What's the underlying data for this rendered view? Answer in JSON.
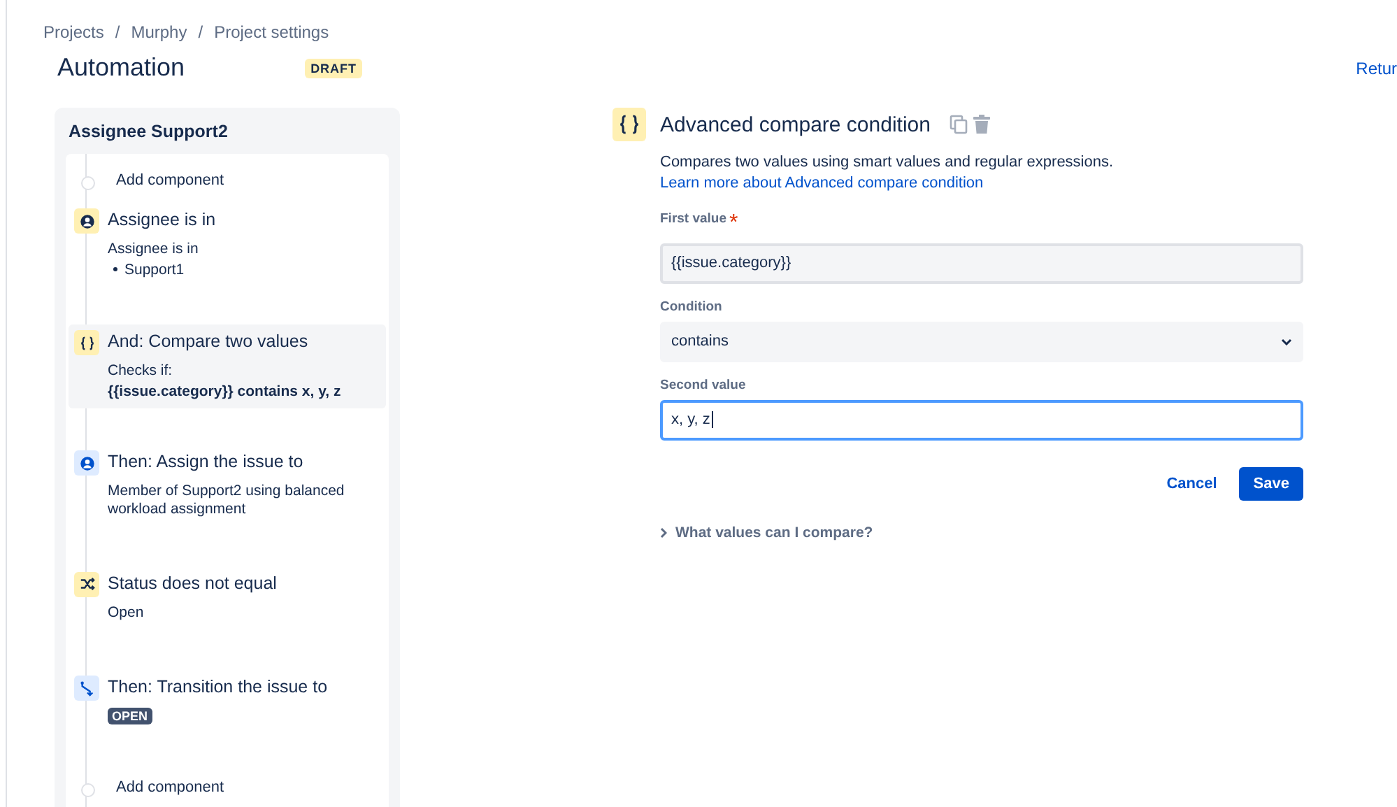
{
  "breadcrumbs": [
    "Projects",
    "Murphy",
    "Project settings"
  ],
  "breadcrumb_separator": "/",
  "title": "Automation",
  "status_badge": "DRAFT",
  "return_link": "Retur",
  "rule": {
    "name": "Assignee Support2",
    "steps": [
      {
        "kind": "add",
        "title": "Add component",
        "selected": false
      },
      {
        "kind": "user-condition",
        "title": "Assignee is in",
        "selected": false,
        "details": [
          {
            "kind": "plain",
            "text": "Assignee is in"
          },
          {
            "kind": "bullet",
            "text": "Support1"
          }
        ]
      },
      {
        "kind": "compare-condition",
        "title": "And: Compare two values",
        "selected": true,
        "details": [
          {
            "kind": "plain",
            "text": "Checks if:"
          },
          {
            "kind": "bold",
            "text": "{{issue.category}} contains x, y, z"
          }
        ]
      },
      {
        "kind": "assign-action",
        "title": "Then: Assign the issue to",
        "selected": false,
        "details": [
          {
            "kind": "plain",
            "text": "Member of Support2 using balanced workload assignment"
          }
        ]
      },
      {
        "kind": "status-condition",
        "title": "Status does not equal",
        "selected": false,
        "details": [
          {
            "kind": "plain",
            "text": "Open"
          }
        ]
      },
      {
        "kind": "transition-action",
        "title": "Then: Transition the issue to",
        "selected": false,
        "details": [
          {
            "kind": "lozenge",
            "text": "OPEN"
          }
        ]
      },
      {
        "kind": "add",
        "title": "Add component",
        "selected": false
      }
    ]
  },
  "editor": {
    "title": "Advanced compare condition",
    "description": "Compares two values using smart values and regular expressions.",
    "learn_more_link": "Learn more about Advanced compare condition",
    "fields": [
      {
        "kind": "text",
        "label": "First value",
        "required": true,
        "value": "{{issue.category}}",
        "focused": false
      },
      {
        "kind": "select",
        "label": "Condition",
        "required": false,
        "value": "contains",
        "focused": false
      },
      {
        "kind": "text",
        "label": "Second value",
        "required": false,
        "value": "x, y, z",
        "focused": true
      }
    ],
    "required_marker": "*",
    "cancel_button": "Cancel",
    "save_button": "Save",
    "help_toggle": "What values can I compare?"
  }
}
